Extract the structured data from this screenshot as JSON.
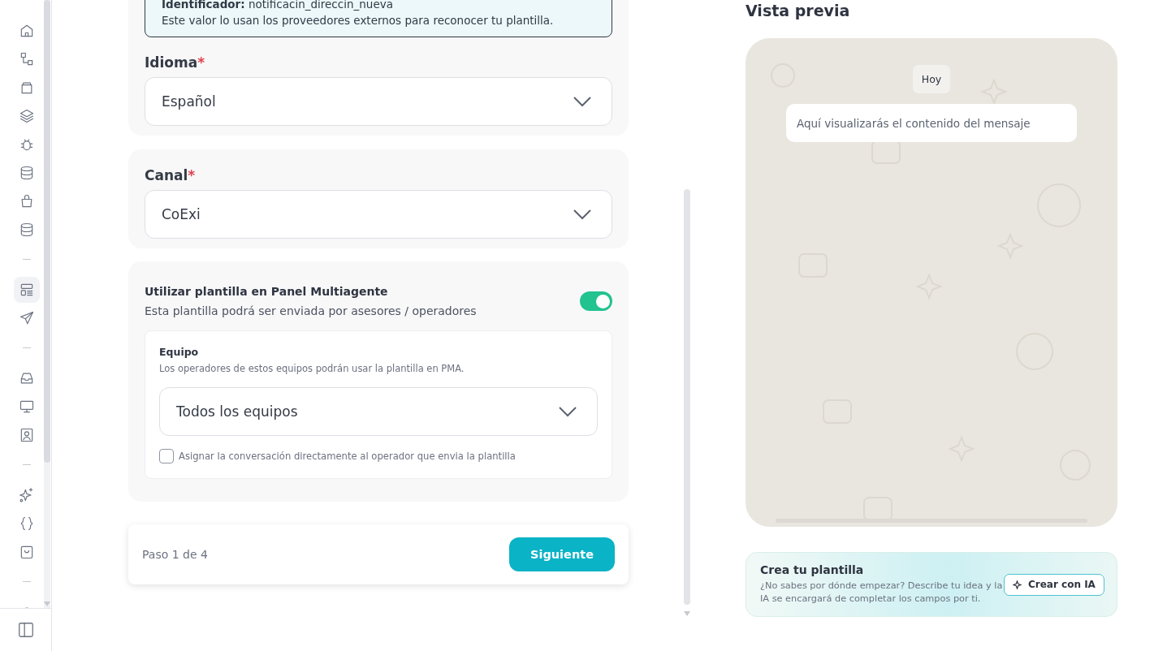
{
  "sidebar": {
    "groups": [
      {
        "items": [
          {
            "selected": false
          },
          {
            "selected": false
          },
          {
            "selected": false
          },
          {
            "selected": false
          },
          {
            "selected": false
          },
          {
            "selected": false
          },
          {
            "selected": false
          },
          {
            "selected": false
          }
        ]
      },
      {
        "items": [
          {
            "selected": true
          },
          {
            "selected": false
          }
        ]
      },
      {
        "items": [
          {
            "selected": false
          },
          {
            "selected": false
          },
          {
            "selected": false
          }
        ]
      },
      {
        "items": [
          {
            "selected": false
          },
          {
            "selected": false
          },
          {
            "selected": false
          }
        ]
      },
      {
        "items": [
          {
            "selected": false
          }
        ]
      }
    ]
  },
  "template_form": {
    "identifier": {
      "text": "**Identificador:** notificacin_direccin_nueva",
      "note": "Este valor lo usan los proveedores externos para reconocer tu plantilla."
    },
    "language": {
      "label": "Idioma",
      "required_mark": "*",
      "value": "Español"
    },
    "channel": {
      "label": "Canal",
      "required_mark": "*",
      "value": "CoExi"
    },
    "multiagent": {
      "title": "Utilizar plantilla en Panel Multiagente",
      "description": "Esta plantilla podrá ser enviada por asesores / operadores",
      "on": true,
      "team": {
        "label": "Equipo",
        "description": "Los operadores de estos equipos podrán usar la plantilla en PMA.",
        "value": "Todos los equipos"
      },
      "assign": {
        "label": "Asignar la conversación directamente al operador que envia la plantilla",
        "checked": false
      }
    }
  },
  "footer": {
    "step": "Paso 1 de 4",
    "next_button": "Siguiente"
  },
  "preview": {
    "title": "Vista previa",
    "date_chip": "Hoy",
    "message": "Aquí visualizarás el contenido del mensaje"
  },
  "ai_card": {
    "title": "Crea tu plantilla",
    "description": "¿No sabes por dónde empezar? Describe tu idea y la IA se encargará de completar los campos por ti.",
    "button": "Crear con IA"
  }
}
